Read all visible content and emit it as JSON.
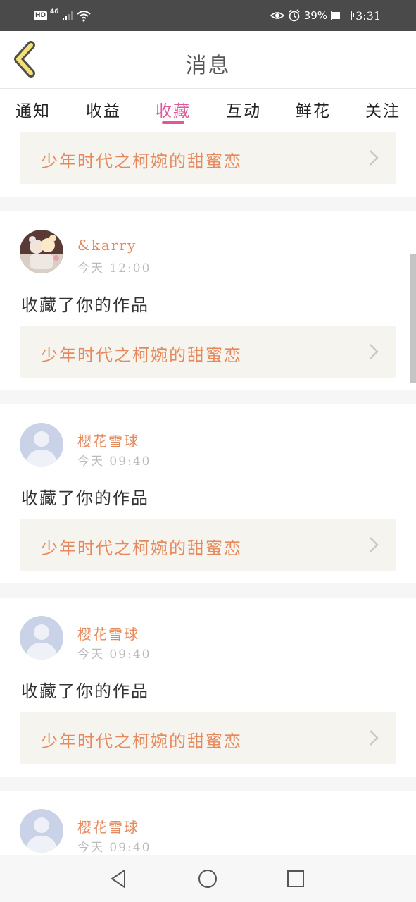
{
  "status_bar": {
    "hd": "HD",
    "network": "46",
    "battery": "39%",
    "battery_level": 0.39,
    "time": "3:31"
  },
  "header": {
    "title": "消息",
    "back_icon": "chevron-left-icon",
    "back_icon_color": "#f2e07a"
  },
  "tabs": [
    {
      "label": "通知",
      "active": false
    },
    {
      "label": "收益",
      "active": false
    },
    {
      "label": "收藏",
      "active": true
    },
    {
      "label": "互动",
      "active": false
    },
    {
      "label": "鲜花",
      "active": false
    },
    {
      "label": "关注",
      "active": false
    }
  ],
  "accent_color": "#e0589c",
  "feed": {
    "top_partial_card": {
      "book_title": "少年时代之柯婉的甜蜜恋"
    },
    "items": [
      {
        "username": "&karry",
        "time": "今天 12:00",
        "action": "收藏了你的作品",
        "book_title": "少年时代之柯婉的甜蜜恋",
        "avatar": "photo-avatar"
      },
      {
        "username": "樱花雪球",
        "time": "今天 09:40",
        "action": "收藏了你的作品",
        "book_title": "少年时代之柯婉的甜蜜恋",
        "avatar": "default-user-avatar"
      },
      {
        "username": "樱花雪球",
        "time": "今天 09:40",
        "action": "收藏了你的作品",
        "book_title": "少年时代之柯婉的甜蜜恋",
        "avatar": "default-user-avatar"
      },
      {
        "username": "樱花雪球",
        "time": "今天 09:40",
        "action": "",
        "book_title": "",
        "avatar": "default-user-avatar"
      }
    ]
  },
  "nav_bar": {
    "icons": [
      "back-triangle-icon",
      "home-circle-icon",
      "recents-square-icon"
    ]
  }
}
